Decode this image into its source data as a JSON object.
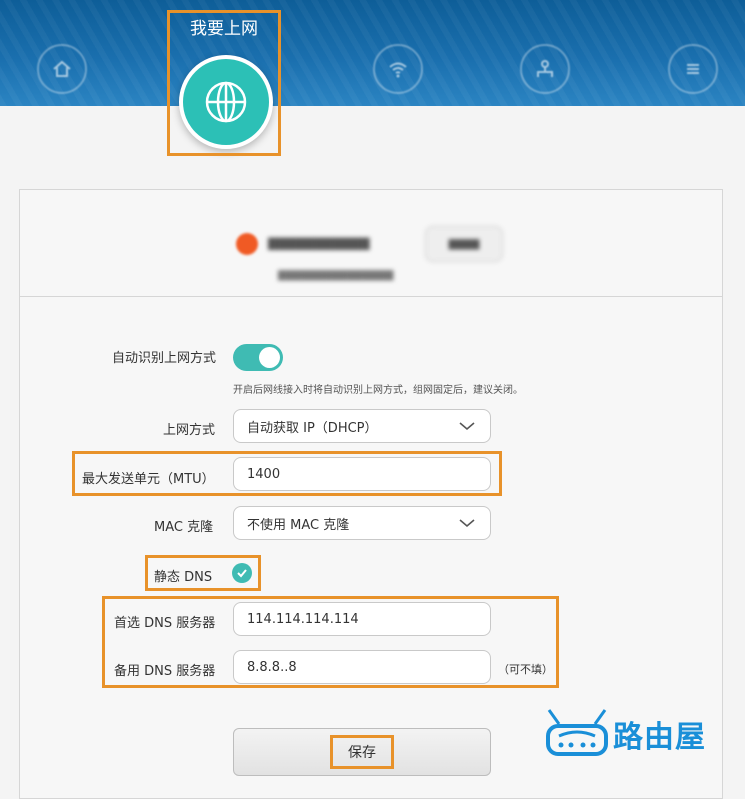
{
  "header": {
    "active_tab": "我要上网",
    "tabs": [
      {
        "icon": "home-icon"
      },
      {
        "icon": "wifi-icon"
      },
      {
        "icon": "network-icon"
      },
      {
        "icon": "menu-icon"
      }
    ],
    "active_icon": "globe-icon",
    "active_color": "#2cc0b6"
  },
  "form": {
    "auto_detect_label": "自动识别上网方式",
    "auto_detect_on": true,
    "auto_detect_hint": "开启后网线接入时将自动识别上网方式，组网固定后，建议关闭。",
    "connection_label": "上网方式",
    "connection_value": "自动获取 IP（DHCP）",
    "mtu_label": "最大发送单元（MTU）",
    "mtu_value": "1400",
    "mac_label": "MAC 克隆",
    "mac_value": "不使用 MAC 克隆",
    "static_dns_label": "静态 DNS",
    "static_dns_checked": true,
    "primary_dns_label": "首选 DNS 服务器",
    "primary_dns_value": "114.114.114.114",
    "secondary_dns_label": "备用 DNS 服务器",
    "secondary_dns_value": "8.8.8..8",
    "optional_note": "（可不填）",
    "save_label": "保存"
  },
  "watermark": {
    "text": "路由屋"
  },
  "colors": {
    "accent": "#3fbbb3",
    "highlight": "#e8922a",
    "status": "#f05a24",
    "header": "#1a6fae"
  }
}
